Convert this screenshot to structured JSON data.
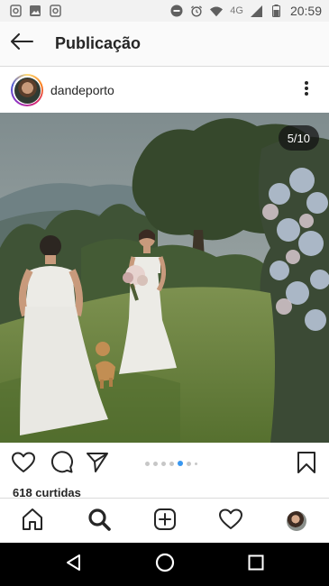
{
  "status_bar": {
    "network": "4G",
    "time": "20:59"
  },
  "header": {
    "title": "Publicação"
  },
  "post": {
    "username": "dandeporto",
    "counter": "5/10",
    "likes": "618 curtidas",
    "carousel": {
      "total_dots": 7,
      "active_index": 4
    }
  },
  "colors": {
    "accent": "#3897f0",
    "text": "#262626",
    "divider": "#dbdbdb"
  },
  "icons": {
    "back": "arrow-left-icon",
    "more": "more-vertical-icon",
    "like": "heart-icon",
    "comment": "comment-icon",
    "share": "send-icon",
    "save": "bookmark-icon",
    "home": "home-icon",
    "search": "search-icon",
    "new_post": "add-post-icon",
    "activity": "heart-icon",
    "profile": "profile-avatar"
  }
}
